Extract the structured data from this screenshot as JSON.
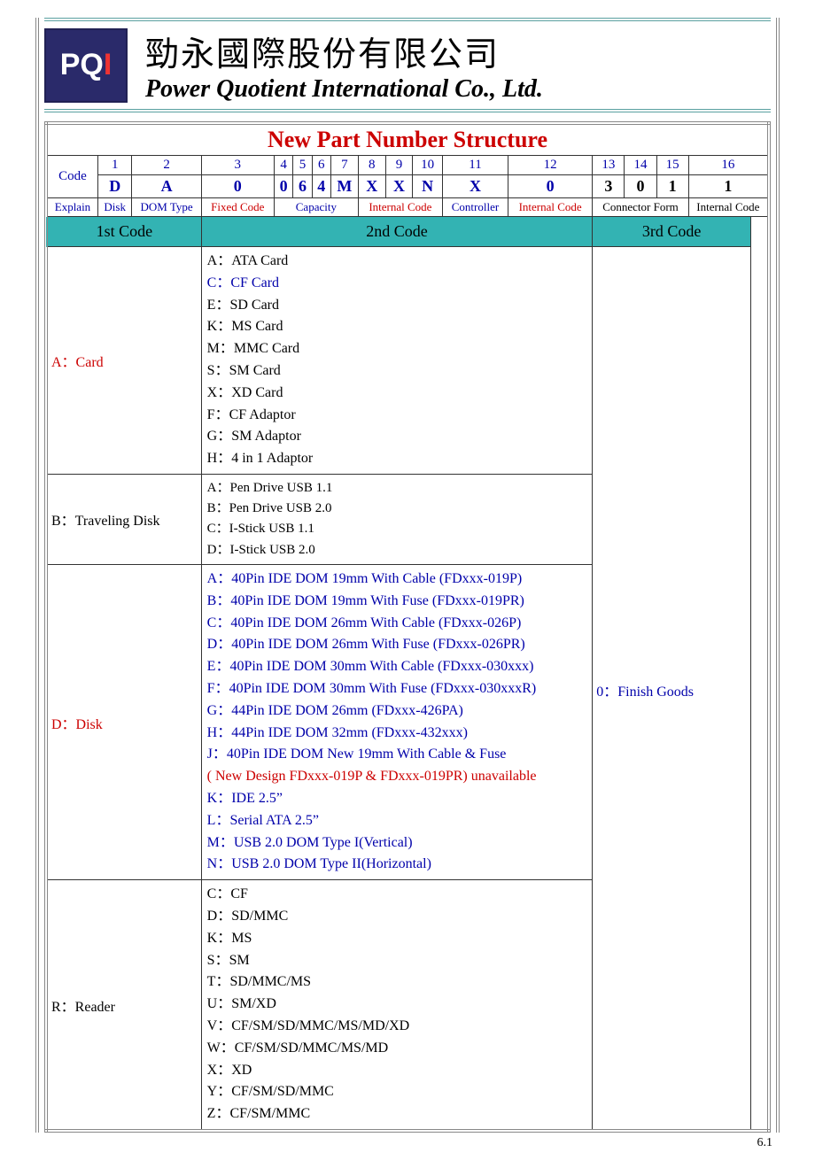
{
  "header": {
    "logo_text_left": "PQ",
    "logo_text_right": "I",
    "cjk_name": "勁永國際股份有限公司",
    "eng_name": "Power Quotient International Co., Ltd."
  },
  "title": "New Part Number Structure",
  "code_label": "Code",
  "explain_label": "Explain",
  "positions": [
    "1",
    "2",
    "3",
    "4",
    "5",
    "6",
    "7",
    "8",
    "9",
    "10",
    "11",
    "12",
    "13",
    "14",
    "15",
    "16"
  ],
  "values": [
    "D",
    "A",
    "0",
    "0",
    "6",
    "4",
    "M",
    "X",
    "X",
    "N",
    "X",
    "0",
    "3",
    "0",
    "1",
    "1"
  ],
  "explain": [
    "Disk",
    "DOM Type",
    "Fixed Code",
    "Capacity",
    "Internal Code",
    "Controller",
    "Internal Code",
    "Connector Form",
    "Internal Code"
  ],
  "section_headers": {
    "first": "1st Code",
    "second": "2nd Code",
    "third": "3rd  Code"
  },
  "third_col_text": "0：Finish Goods",
  "rows": {
    "a": {
      "label": "A：Card",
      "items": [
        {
          "t": "A：ATA Card",
          "c": "black"
        },
        {
          "t": "C：CF Card",
          "c": "blue"
        },
        {
          "t": "E：SD Card",
          "c": "black"
        },
        {
          "t": "K：MS Card",
          "c": "black"
        },
        {
          "t": "M：MMC Card",
          "c": "black"
        },
        {
          "t": "S：SM Card",
          "c": "black"
        },
        {
          "t": "X：XD Card",
          "c": "black"
        },
        {
          "t": "F：CF Adaptor",
          "c": "black"
        },
        {
          "t": "G：SM Adaptor",
          "c": "black"
        },
        {
          "t": "H：4 in 1 Adaptor",
          "c": "black"
        }
      ]
    },
    "b": {
      "label": "B：Traveling Disk",
      "items": [
        {
          "t": "A：Pen Drive USB 1.1",
          "c": "black"
        },
        {
          "t": "B：Pen Drive USB 2.0",
          "c": "black"
        },
        {
          "t": "C：I-Stick USB 1.1",
          "c": "black"
        },
        {
          "t": "D：I-Stick USB 2.0",
          "c": "black"
        }
      ]
    },
    "d": {
      "label": "D：Disk",
      "items": [
        {
          "t": "A：40Pin IDE DOM 19mm With Cable (FDxxx-019P)",
          "c": "blue"
        },
        {
          "t": "B：40Pin IDE DOM 19mm With Fuse  (FDxxx-019PR)",
          "c": "blue"
        },
        {
          "t": "C：40Pin IDE DOM 26mm With Cable  (FDxxx-026P)",
          "c": "blue"
        },
        {
          "t": "D：40Pin IDE DOM 26mm With Fuse    (FDxxx-026PR)",
          "c": "blue"
        },
        {
          "t": "E：40Pin IDE DOM 30mm With Cable   (FDxxx-030xxx)",
          "c": "blue"
        },
        {
          "t": "F：40Pin IDE DOM 30mm With Fuse     (FDxxx-030xxxR)",
          "c": "blue"
        },
        {
          "t": "G：44Pin  IDE DOM  26mm                    (FDxxx-426PA)",
          "c": "blue"
        },
        {
          "t": "H：44Pin  IDE DOM  32mm                    (FDxxx-432xxx)",
          "c": "blue"
        },
        {
          "t": "J：40Pin IDE DOM New 19mm With Cable & Fuse",
          "c": "blue"
        },
        {
          "t": "( New Design FDxxx-019P & FDxxx-019PR)    unavailable",
          "c": "red"
        },
        {
          "t": "K：IDE 2.5”",
          "c": "blue"
        },
        {
          "t": "L：Serial ATA 2.5”",
          "c": "blue"
        },
        {
          "t": "M：USB 2.0 DOM Type I(Vertical)",
          "c": "blue"
        },
        {
          "t": "N：USB 2.0 DOM Type II(Horizontal)",
          "c": "blue"
        }
      ]
    },
    "r": {
      "label": "R：Reader",
      "items": [
        {
          "t": "C：CF",
          "c": "black"
        },
        {
          "t": "D：SD/MMC",
          "c": "black"
        },
        {
          "t": "K：MS",
          "c": "black"
        },
        {
          "t": "S：SM",
          "c": "black"
        },
        {
          "t": "T：SD/MMC/MS",
          "c": "black"
        },
        {
          "t": "U：SM/XD",
          "c": "black"
        },
        {
          "t": "V：CF/SM/SD/MMC/MS/MD/XD",
          "c": "black"
        },
        {
          "t": "W：CF/SM/SD/MMC/MS/MD",
          "c": "black"
        },
        {
          "t": "X：XD",
          "c": "black"
        },
        {
          "t": "Y：CF/SM/SD/MMC",
          "c": "black"
        },
        {
          "t": "Z：CF/SM/MMC",
          "c": "black"
        }
      ]
    }
  },
  "page_number": "6.1"
}
